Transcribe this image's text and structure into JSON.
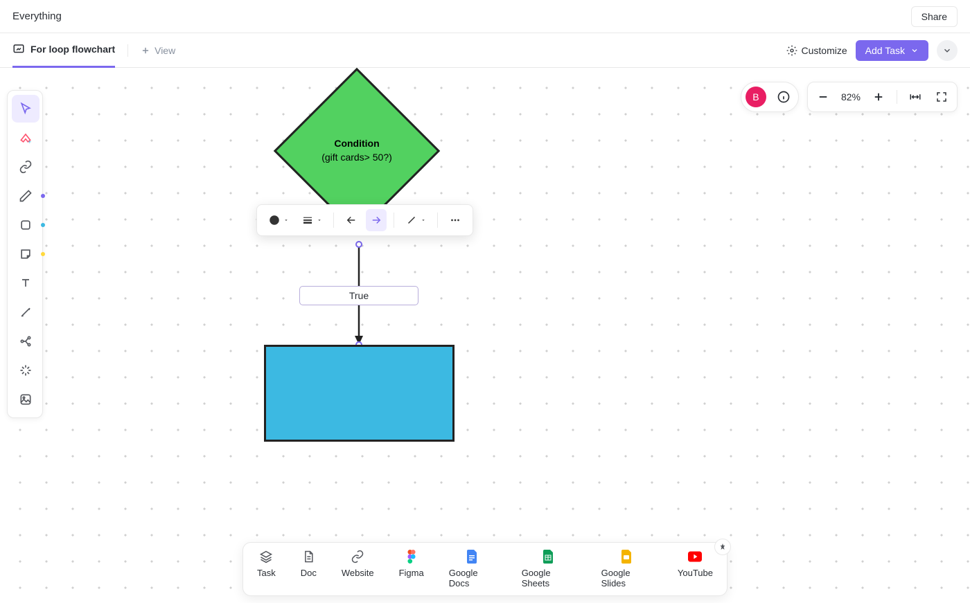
{
  "header": {
    "title": "Everything",
    "share_label": "Share"
  },
  "tabs": {
    "active_tab": "For loop flowchart",
    "add_view_label": "View",
    "customize_label": "Customize",
    "add_task_label": "Add Task"
  },
  "zoom": {
    "level": "82%"
  },
  "user": {
    "avatar_letter": "B"
  },
  "flowchart": {
    "condition_title": "Condition",
    "condition_detail": "(gift cards> 50?)",
    "connector_label": "True"
  },
  "bottom_bar": {
    "items": [
      {
        "label": "Task"
      },
      {
        "label": "Doc"
      },
      {
        "label": "Website"
      },
      {
        "label": "Figma"
      },
      {
        "label": "Google Docs"
      },
      {
        "label": "Google Sheets"
      },
      {
        "label": "Google Slides"
      },
      {
        "label": "YouTube"
      }
    ]
  }
}
